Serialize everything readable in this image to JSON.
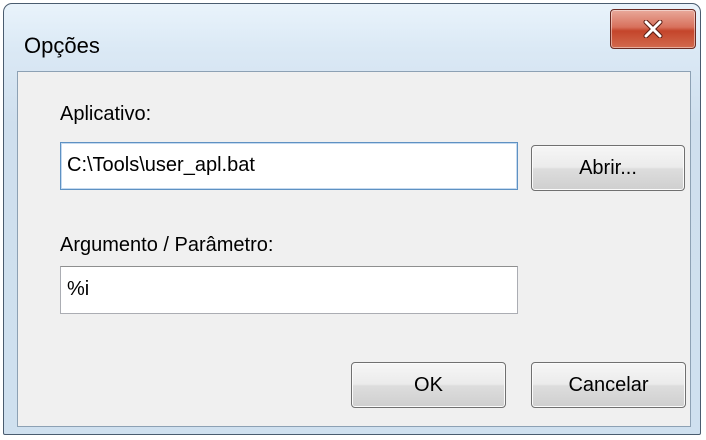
{
  "window": {
    "title": "Opções",
    "close_icon": "close-x-icon"
  },
  "application": {
    "label": "Aplicativo:",
    "value": "C:\\Tools\\user_apl.bat",
    "browse_label": "Abrir..."
  },
  "argument": {
    "label": "Argumento / Parâmetro:",
    "value": "%i"
  },
  "buttons": {
    "ok_label": "OK",
    "cancel_label": "Cancelar"
  },
  "colors": {
    "titlebar": "#dbe9f5",
    "close_button": "#c4452b",
    "client_background": "#f0f0f0"
  }
}
